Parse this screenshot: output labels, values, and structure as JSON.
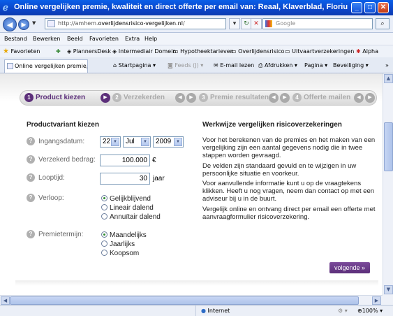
{
  "window": {
    "title": "Online vergelijken premie, kwaliteit en direct offerte per email van: Reaal, Klaverblad, Floriu - Windows Inte...",
    "minimize": "_",
    "maximize": "□",
    "close": "✕"
  },
  "address": {
    "url_prefix": "http://amhem.",
    "url_domain": "overlijdensrisico-vergelijken.nl",
    "url_suffix": "/",
    "search_placeholder": "Google"
  },
  "menu": [
    "Bestand",
    "Bewerken",
    "Beeld",
    "Favorieten",
    "Extra",
    "Help"
  ],
  "favorites": {
    "label": "Favorieten",
    "items": [
      "PlannersDesk",
      "Intermediair Domein",
      "Hypotheektarieven",
      "Overlijdensrisico",
      "Uitvaartverzekeringen",
      "Alpha"
    ]
  },
  "tabs": {
    "active_tab": "Online vergelijken premie, ...",
    "commands": [
      "Startpagina",
      "Feeds (J)",
      "E-mail lezen",
      "Afdrukken",
      "Pagina",
      "Beveiliging"
    ]
  },
  "steps": [
    {
      "num": "1",
      "label": "Product kiezen"
    },
    {
      "num": "2",
      "label": "Verzekerden"
    },
    {
      "num": "3",
      "label": "Premie resultaten"
    },
    {
      "num": "4",
      "label": "Offerte mailen"
    }
  ],
  "form": {
    "title": "Productvariant kiezen",
    "start_date_label": "Ingangsdatum:",
    "day": "22",
    "month": "Jul",
    "year": "2009",
    "insured_amount_label": "Verzekerd bedrag:",
    "insured_amount": "100.000",
    "currency": "€",
    "term_label": "Looptijd:",
    "term": "30",
    "term_unit": "jaar",
    "course_label": "Verloop:",
    "course_options": [
      "Gelijkblijvend",
      "Lineair dalend",
      "Annuïtair dalend"
    ],
    "course_selected": 0,
    "premium_term_label": "Premietermijn:",
    "premium_options": [
      "Maandelijks",
      "Jaarlijks",
      "Koopsom"
    ],
    "premium_selected": 0,
    "next_label": "volgende »"
  },
  "info": {
    "title": "Werkwijze vergelijken risicoverzekeringen",
    "paragraphs": [
      "Voor het berekenen van de premies en het maken van een vergelijking zijn een aantal gegevens nodig die in twee stappen worden gevraagd.",
      "De velden zijn standaard gevuld en te wijzigen in uw persoonlijke situatie en voorkeur.",
      "Voor aanvullende informatie kunt u op de vraagtekens klikken. Heeft u nog vragen, neem dan contact op met een adviseur bij u in de buurt.",
      "Vergelijk online en ontvang direct per email een offerte met aanvraagformulier risicoverzekering."
    ]
  },
  "status": {
    "zone": "Internet",
    "zoom": "100%"
  }
}
